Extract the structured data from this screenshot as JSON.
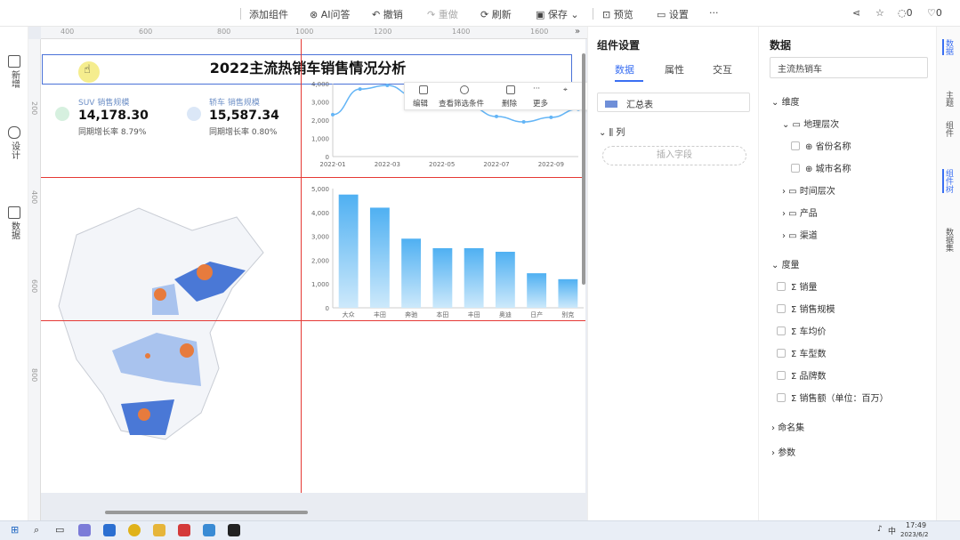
{
  "toolbar": {
    "add_component": "添加组件",
    "ai_ask": "AI问答",
    "undo": "撤销",
    "redo": "重做",
    "refresh": "刷新",
    "save": "保存",
    "preview": "预览",
    "settings": "设置",
    "more": "···",
    "comment_count": "0",
    "like_count": "0"
  },
  "left_nav": {
    "items": [
      {
        "label": "新增"
      },
      {
        "label": "设计"
      },
      {
        "label": "数据"
      }
    ]
  },
  "ruler": {
    "top": [
      "400",
      "600",
      "800",
      "1000",
      "1200",
      "1400",
      "1600"
    ],
    "left": [
      "200",
      "400",
      "600",
      "800"
    ]
  },
  "dashboard": {
    "title": "2022主流热销车销售情况分析",
    "kpi": [
      {
        "label": "SUV 销售规模",
        "value": "14,178.30",
        "sub": "同期增长率 8.79%"
      },
      {
        "label": "轿车 销售规模",
        "value": "15,587.34",
        "sub": "同期增长率 0.80%"
      }
    ],
    "float_toolbar": {
      "edit": "编辑",
      "filter": "查看筛选条件",
      "delete": "删除",
      "more": "更多"
    }
  },
  "chart_data": [
    {
      "type": "line",
      "x": [
        "2022-01",
        "2022-02",
        "2022-03",
        "2022-04",
        "2022-05",
        "2022-06",
        "2022-07",
        "2022-08",
        "2022-09",
        "2022-10"
      ],
      "x_tick_labels": [
        "2022-01",
        "2022-03",
        "2022-05",
        "2022-07",
        "2022-09"
      ],
      "series": [
        {
          "values": [
            2300,
            3700,
            3900,
            3300,
            3350,
            2750,
            2200,
            1900,
            2150,
            2600
          ]
        }
      ],
      "ylim": [
        0,
        4000
      ],
      "y_ticks": [
        "0",
        "1,000",
        "2,000",
        "3,000",
        "4,000"
      ],
      "color": "#64b5f6",
      "grid": false
    },
    {
      "type": "bar",
      "categories": [
        "大众",
        "丰田",
        "奔驰",
        "本田",
        "丰田",
        "奥迪",
        "日产",
        "别克"
      ],
      "values": [
        4750,
        4200,
        2900,
        2500,
        2500,
        2350,
        1450,
        1200
      ],
      "ylim": [
        0,
        5000
      ],
      "y_ticks": [
        "0",
        "1,000",
        "2,000",
        "3,000",
        "4,000",
        "5,000"
      ],
      "color": "#64b5f6",
      "grid": false
    }
  ],
  "component_settings": {
    "title": "组件设置",
    "tabs": [
      "数据",
      "属性",
      "交互"
    ],
    "summary_table": "汇总表",
    "column_label": "列",
    "insert_field": "插入字段"
  },
  "data_panel": {
    "title": "数据",
    "search_value": "主流热销车",
    "dimension": "维度",
    "geo_level": "地理层次",
    "province": "省份名称",
    "city": "城市名称",
    "time_level": "时间层次",
    "product": "产品",
    "channel": "渠道",
    "measure": "度量",
    "measures": [
      "销量",
      "销售规模",
      "车均价",
      "车型数",
      "品牌数",
      "销售额（单位：百万）"
    ],
    "named_sets": "命名集",
    "params": "参数"
  },
  "right_rail": [
    "数据",
    "主题",
    "组件",
    "组件树",
    "数据集"
  ],
  "taskbar": {
    "time": "17:49",
    "date": "2023/6/2",
    "lang": "中"
  }
}
